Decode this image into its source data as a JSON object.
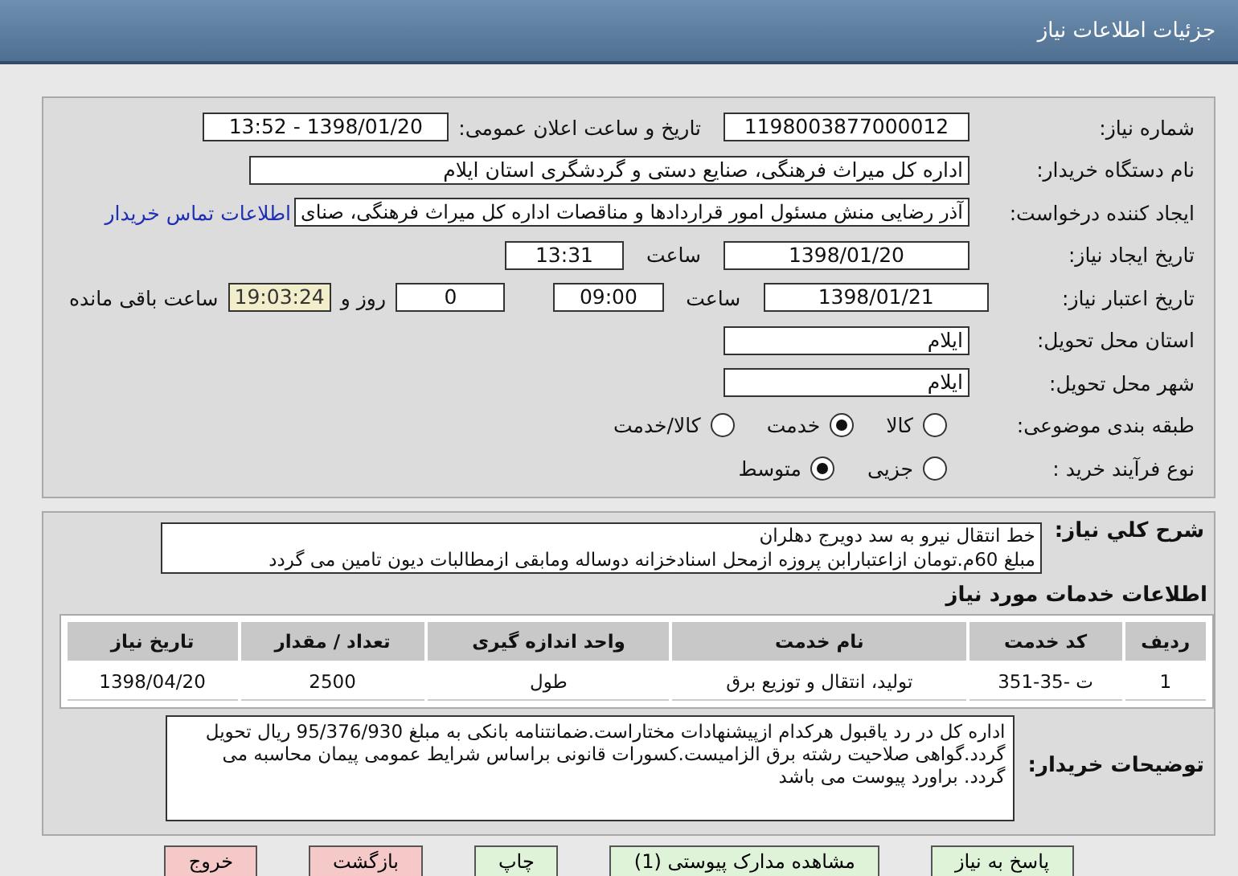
{
  "header": {
    "title": "جزئیات اطلاعات نیاز"
  },
  "info": {
    "need_number_label": "شماره نیاز:",
    "need_number": "1198003877000012",
    "announce_label": "تاریخ و ساعت اعلان عمومی:",
    "announce_value": "1398/01/20 - 13:52",
    "buyer_label": "نام دستگاه خریدار:",
    "buyer": "اداره کل میراث فرهنگی، صنایع دستی و گردشگری استان ایلام",
    "creator_label": "ایجاد کننده درخواست:",
    "creator": "آذر رضایی منش مسئول امور قراردادها و مناقصات اداره کل میراث فرهنگی، صنای",
    "contact_link": "اطلاعات تماس خریدار",
    "created_label": "تاریخ ایجاد نیاز:",
    "created_date": "1398/01/20",
    "created_time_label": "ساعت",
    "created_time": "13:31",
    "valid_label": "تاریخ اعتبار نیاز:",
    "valid_date": "1398/01/21",
    "valid_time_label": "ساعت",
    "valid_time": "09:00",
    "days": "0",
    "days_label": "روز و",
    "remaining": "19:03:24",
    "remaining_label": "ساعت باقی مانده",
    "province_label": "استان محل تحویل:",
    "province": "ایلام",
    "city_label": "شهر محل تحویل:",
    "city": "ایلام",
    "category_label": "طبقه بندی موضوعی:",
    "category_options": [
      {
        "label": "کالا",
        "selected": false
      },
      {
        "label": "خدمت",
        "selected": true
      },
      {
        "label": "کالا/خدمت",
        "selected": false
      }
    ],
    "process_label": "نوع فرآیند خرید :",
    "process_options": [
      {
        "label": "جزیی",
        "selected": false
      },
      {
        "label": "متوسط",
        "selected": true
      }
    ]
  },
  "summary": {
    "label": "شرح کلي نیاز:",
    "lines": [
      "خط انتقال نیرو به سد دویرج دهلران",
      "مبلغ 60م.تومان ازاعتبارابن پروزه ازمحل اسنادخزانه دوساله ومابقی ازمطالبات دیون تامین می گردد"
    ],
    "services_title": "اطلاعات خدمات مورد نیاز",
    "table": {
      "columns": [
        "ردیف",
        "کد خدمت",
        "نام خدمت",
        "واحد اندازه گیری",
        "تعداد / مقدار",
        "تاریخ نیاز"
      ],
      "rows": [
        [
          "1",
          "ت -35-351",
          "تولید، انتقال و توزیع برق",
          "طول",
          "2500",
          "1398/04/20"
        ]
      ]
    },
    "notes_label": "توضیحات خریدار:",
    "notes": "اداره کل در رد یاقبول هرکدام ازپیشنهادات مختاراست.ضمانتنامه بانکی به مبلغ 95/376/930 ریال تحویل گردد.گواهی صلاحیت رشته برق الزامیست.کسورات قانونی براساس شرایط عمومی پیمان محاسبه می گردد. براورد پیوست می باشد"
  },
  "buttons": [
    {
      "label": "پاسخ به نیاز",
      "kind": "normal"
    },
    {
      "label": "مشاهده مدارک پیوستی (1)",
      "kind": "normal"
    },
    {
      "label": "چاپ",
      "kind": "normal"
    },
    {
      "label": "بازگشت",
      "kind": "danger"
    },
    {
      "label": "خروج",
      "kind": "danger"
    }
  ]
}
